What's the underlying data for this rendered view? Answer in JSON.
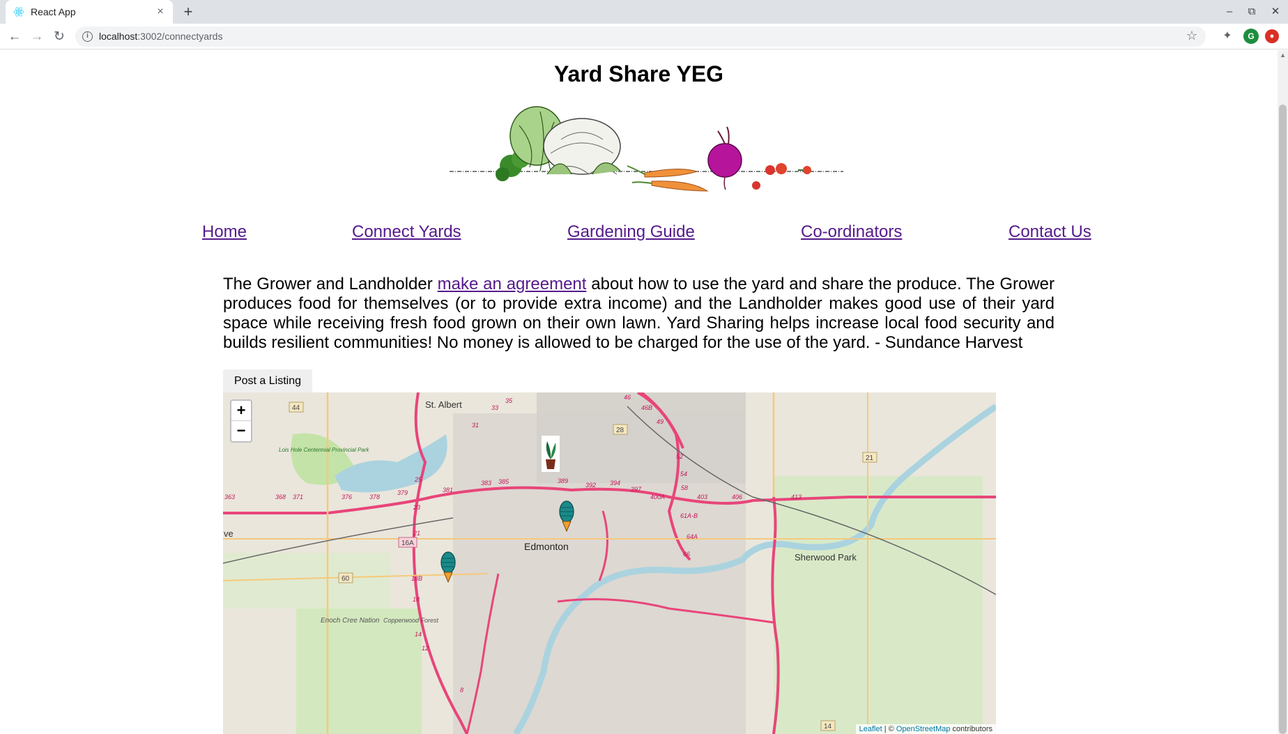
{
  "browser": {
    "tab_title": "React App",
    "tab_close": "×",
    "new_tab": "+",
    "url_host": "localhost",
    "url_path": ":3002/connectyards",
    "profile_initial": "G",
    "window_controls": [
      "minimize",
      "restore",
      "close"
    ]
  },
  "page": {
    "title": "Yard Share YEG",
    "nav": [
      {
        "label": "Home"
      },
      {
        "label": "Connect Yards"
      },
      {
        "label": "Gardening Guide"
      },
      {
        "label": "Co-ordinators"
      },
      {
        "label": "Contact Us"
      }
    ],
    "intro_before": "The Grower and Landholder ",
    "intro_link": "make an agreement",
    "intro_after": " about how to use the yard and share the produce. The Grower produces food for themselves (or to provide extra income) and the Landholder makes good use of their yard space while receiving fresh food grown on their own lawn. Yard Sharing helps increase local food security and builds resilient communities! No money is allowed to be charged for the use of the yard. - Sundance Harvest",
    "post_button": "Post a Listing"
  },
  "map": {
    "zoom_in": "+",
    "zoom_out": "−",
    "attribution_leaflet": "Leaflet",
    "attribution_sep": " | © ",
    "attribution_osm": "OpenStreetMap",
    "attribution_tail": " contributors",
    "place_labels": [
      "St. Albert",
      "Edmonton",
      "Sherwood Park",
      "Enoch Cree Nation",
      "Lois Hole Centennial Provincial Park",
      "Copperwood Forest",
      "ve"
    ],
    "route_shields": [
      "44",
      "28",
      "21",
      "16A",
      "60",
      "14"
    ],
    "exit_numbers": [
      "35",
      "33",
      "31",
      "46",
      "46B",
      "49",
      "52",
      "54",
      "58",
      "61A-B",
      "64A",
      "66",
      "383",
      "385",
      "389",
      "392",
      "394",
      "397",
      "400A",
      "403",
      "406",
      "413",
      "363",
      "368",
      "371",
      "376",
      "378",
      "379",
      "381",
      "25",
      "23",
      "21",
      "18B",
      "18",
      "14",
      "12",
      "8"
    ],
    "markers": [
      {
        "name": "potted-plant-marker"
      },
      {
        "name": "tree-marker"
      },
      {
        "name": "tree-marker"
      }
    ]
  }
}
